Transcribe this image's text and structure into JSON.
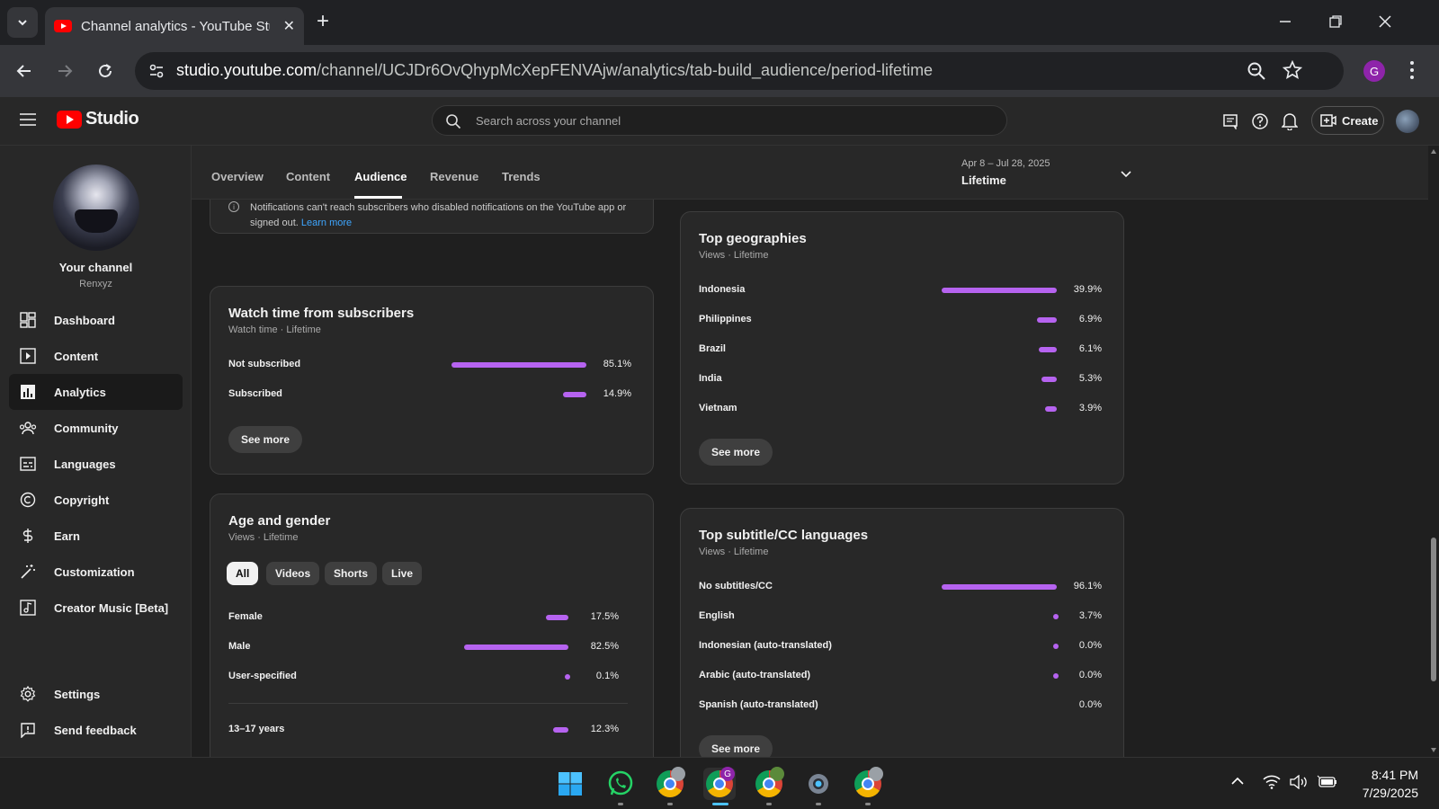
{
  "browser": {
    "tab_title": "Channel analytics - YouTube Studio",
    "url_host": "studio.youtube.com",
    "url_path": "/channel/UCJDr6OvQhypMcXepFENVAjw/analytics/tab-build_audience/period-lifetime",
    "profile_initial": "G"
  },
  "studio": {
    "logo_text": "Studio",
    "search_placeholder": "Search across your channel",
    "create_label": "Create"
  },
  "sidebar": {
    "channel_name": "Your channel",
    "channel_handle": "Renxyz",
    "items": [
      {
        "label": "Dashboard",
        "icon": "dashboard-icon"
      },
      {
        "label": "Content",
        "icon": "content-icon"
      },
      {
        "label": "Analytics",
        "icon": "analytics-icon",
        "active": true
      },
      {
        "label": "Community",
        "icon": "community-icon"
      },
      {
        "label": "Languages",
        "icon": "languages-icon"
      },
      {
        "label": "Copyright",
        "icon": "copyright-icon"
      },
      {
        "label": "Earn",
        "icon": "earn-icon"
      },
      {
        "label": "Customization",
        "icon": "customization-icon"
      },
      {
        "label": "Creator Music [Beta]",
        "icon": "creator-music-icon"
      }
    ],
    "bottom_items": [
      {
        "label": "Settings",
        "icon": "settings-icon"
      },
      {
        "label": "Send feedback",
        "icon": "feedback-icon"
      }
    ]
  },
  "analytics": {
    "tabs": [
      "Overview",
      "Content",
      "Audience",
      "Revenue",
      "Trends"
    ],
    "active_tab": "Audience",
    "period_range": "Apr 8 – Jul 28, 2025",
    "period_value": "Lifetime"
  },
  "notice": {
    "text": "Notifications can't reach subscribers who disabled notifications on the YouTube app or signed out.",
    "link": "Learn more"
  },
  "watch_time": {
    "title": "Watch time from subscribers",
    "subtitle": "Watch time · Lifetime",
    "rows": [
      {
        "label": "Not subscribed",
        "value": "85.1%",
        "fraction": 0.851
      },
      {
        "label": "Subscribed",
        "value": "14.9%",
        "fraction": 0.149
      }
    ],
    "see_more": "See more"
  },
  "age_gender": {
    "title": "Age and gender",
    "subtitle": "Views · Lifetime",
    "chips": [
      "All",
      "Videos",
      "Shorts",
      "Live"
    ],
    "active_chip": "All",
    "rows": [
      {
        "label": "Female",
        "value": "17.5%",
        "fraction": 0.175
      },
      {
        "label": "Male",
        "value": "82.5%",
        "fraction": 0.825
      },
      {
        "label": "User-specified",
        "value": "0.1%",
        "fraction": 0.001
      }
    ],
    "age_rows": [
      {
        "label": "13–17 years",
        "value": "12.3%",
        "fraction": 0.123
      }
    ]
  },
  "geographies": {
    "title": "Top geographies",
    "subtitle": "Views · Lifetime",
    "rows": [
      {
        "label": "Indonesia",
        "value": "39.9%",
        "fraction": 0.399
      },
      {
        "label": "Philippines",
        "value": "6.9%",
        "fraction": 0.069
      },
      {
        "label": "Brazil",
        "value": "6.1%",
        "fraction": 0.061
      },
      {
        "label": "India",
        "value": "5.3%",
        "fraction": 0.053
      },
      {
        "label": "Vietnam",
        "value": "3.9%",
        "fraction": 0.039
      }
    ],
    "see_more": "See more"
  },
  "subtitles": {
    "title": "Top subtitle/CC languages",
    "subtitle": "Views · Lifetime",
    "rows": [
      {
        "label": "No subtitles/CC",
        "value": "96.1%",
        "fraction": 0.961
      },
      {
        "label": "English",
        "value": "3.7%",
        "fraction": 0.037
      },
      {
        "label": "Indonesian (auto-translated)",
        "value": "0.0%",
        "fraction": 0.0001
      },
      {
        "label": "Arabic (auto-translated)",
        "value": "0.0%",
        "fraction": 0.0001
      },
      {
        "label": "Spanish (auto-translated)",
        "value": "0.0%",
        "fraction": 0
      }
    ],
    "see_more": "See more"
  },
  "taskbar": {
    "time": "8:41 PM",
    "date": "7/29/2025",
    "apps": [
      "windows-start-icon",
      "whatsapp-icon",
      "chrome-icon",
      "chrome-profile-g-icon",
      "chrome-icon",
      "settings-icon",
      "chrome-icon"
    ]
  },
  "colors": {
    "accent_bar": "#b663f0",
    "yt_red": "#ff0000",
    "link": "#3ea6ff"
  }
}
